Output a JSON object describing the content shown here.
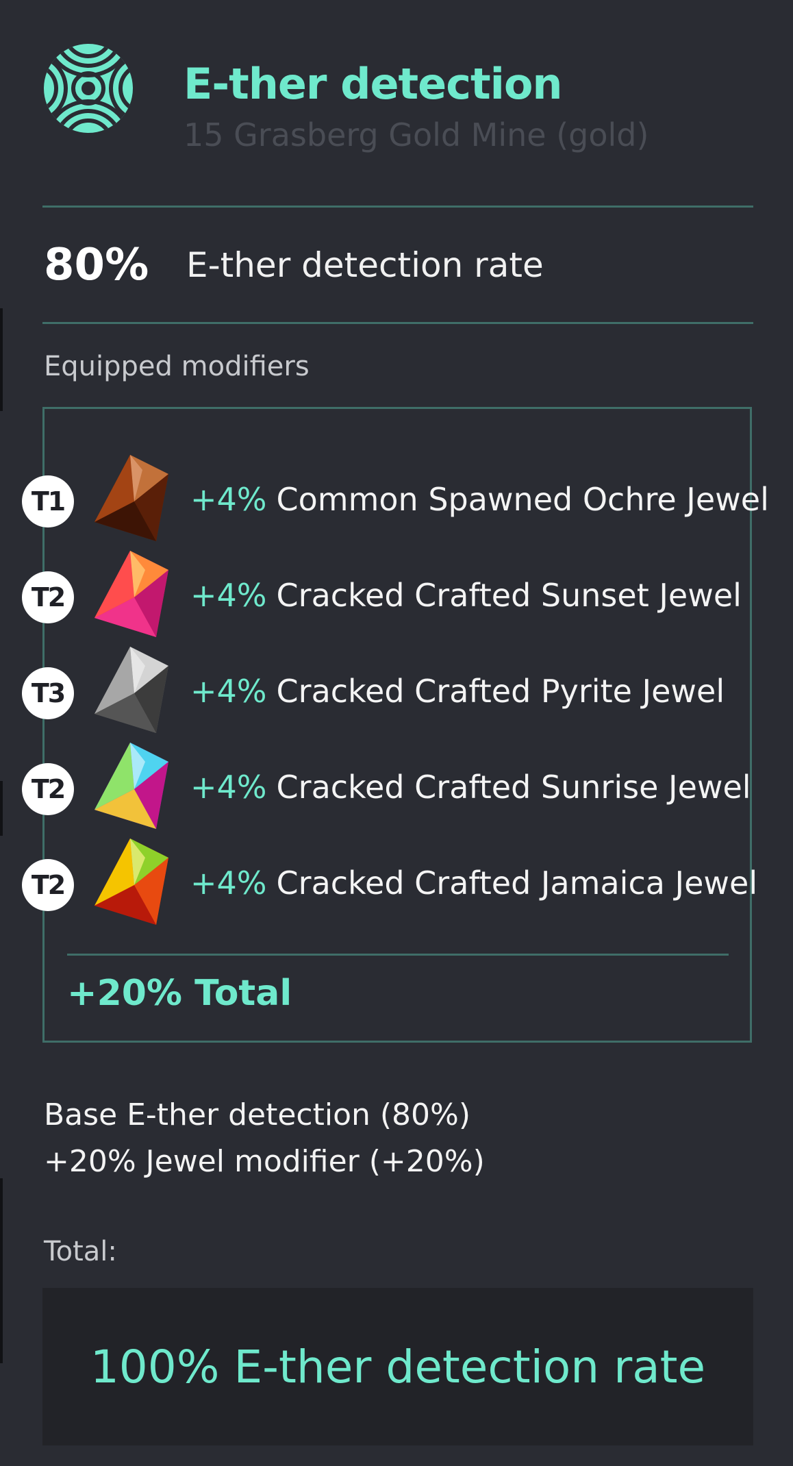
{
  "header": {
    "icon": "radar-detection-icon",
    "title": "E-ther detection",
    "subtitle": "15 Grasberg Gold Mine (gold)"
  },
  "rate": {
    "value": "80%",
    "label": "E-ther detection rate"
  },
  "modifiers": {
    "section_label": "Equipped modifiers",
    "items": [
      {
        "tier": "T1",
        "jewel_icon": "ochre-jewel-icon",
        "percent": "+4%",
        "name": "Common Spawned Ochre Jewel"
      },
      {
        "tier": "T2",
        "jewel_icon": "sunset-jewel-icon",
        "percent": "+4%",
        "name": "Cracked Crafted Sunset Jewel"
      },
      {
        "tier": "T3",
        "jewel_icon": "pyrite-jewel-icon",
        "percent": "+4%",
        "name": "Cracked Crafted Pyrite Jewel"
      },
      {
        "tier": "T2",
        "jewel_icon": "sunrise-jewel-icon",
        "percent": "+4%",
        "name": "Cracked Crafted Sunrise Jewel"
      },
      {
        "tier": "T2",
        "jewel_icon": "jamaica-jewel-icon",
        "percent": "+4%",
        "name": "Cracked Crafted Jamaica Jewel"
      }
    ],
    "total": "+20% Total"
  },
  "calculation": {
    "base_line": "Base E-ther detection (80%)",
    "modifier_line": "+20% Jewel modifier (+20%)",
    "total_label": "Total:",
    "result": "100% E-ther detection rate"
  },
  "colors": {
    "accent": "#6fe9cc",
    "background": "#2a2c33",
    "divider": "#3f6e68",
    "result_background": "#222328"
  }
}
